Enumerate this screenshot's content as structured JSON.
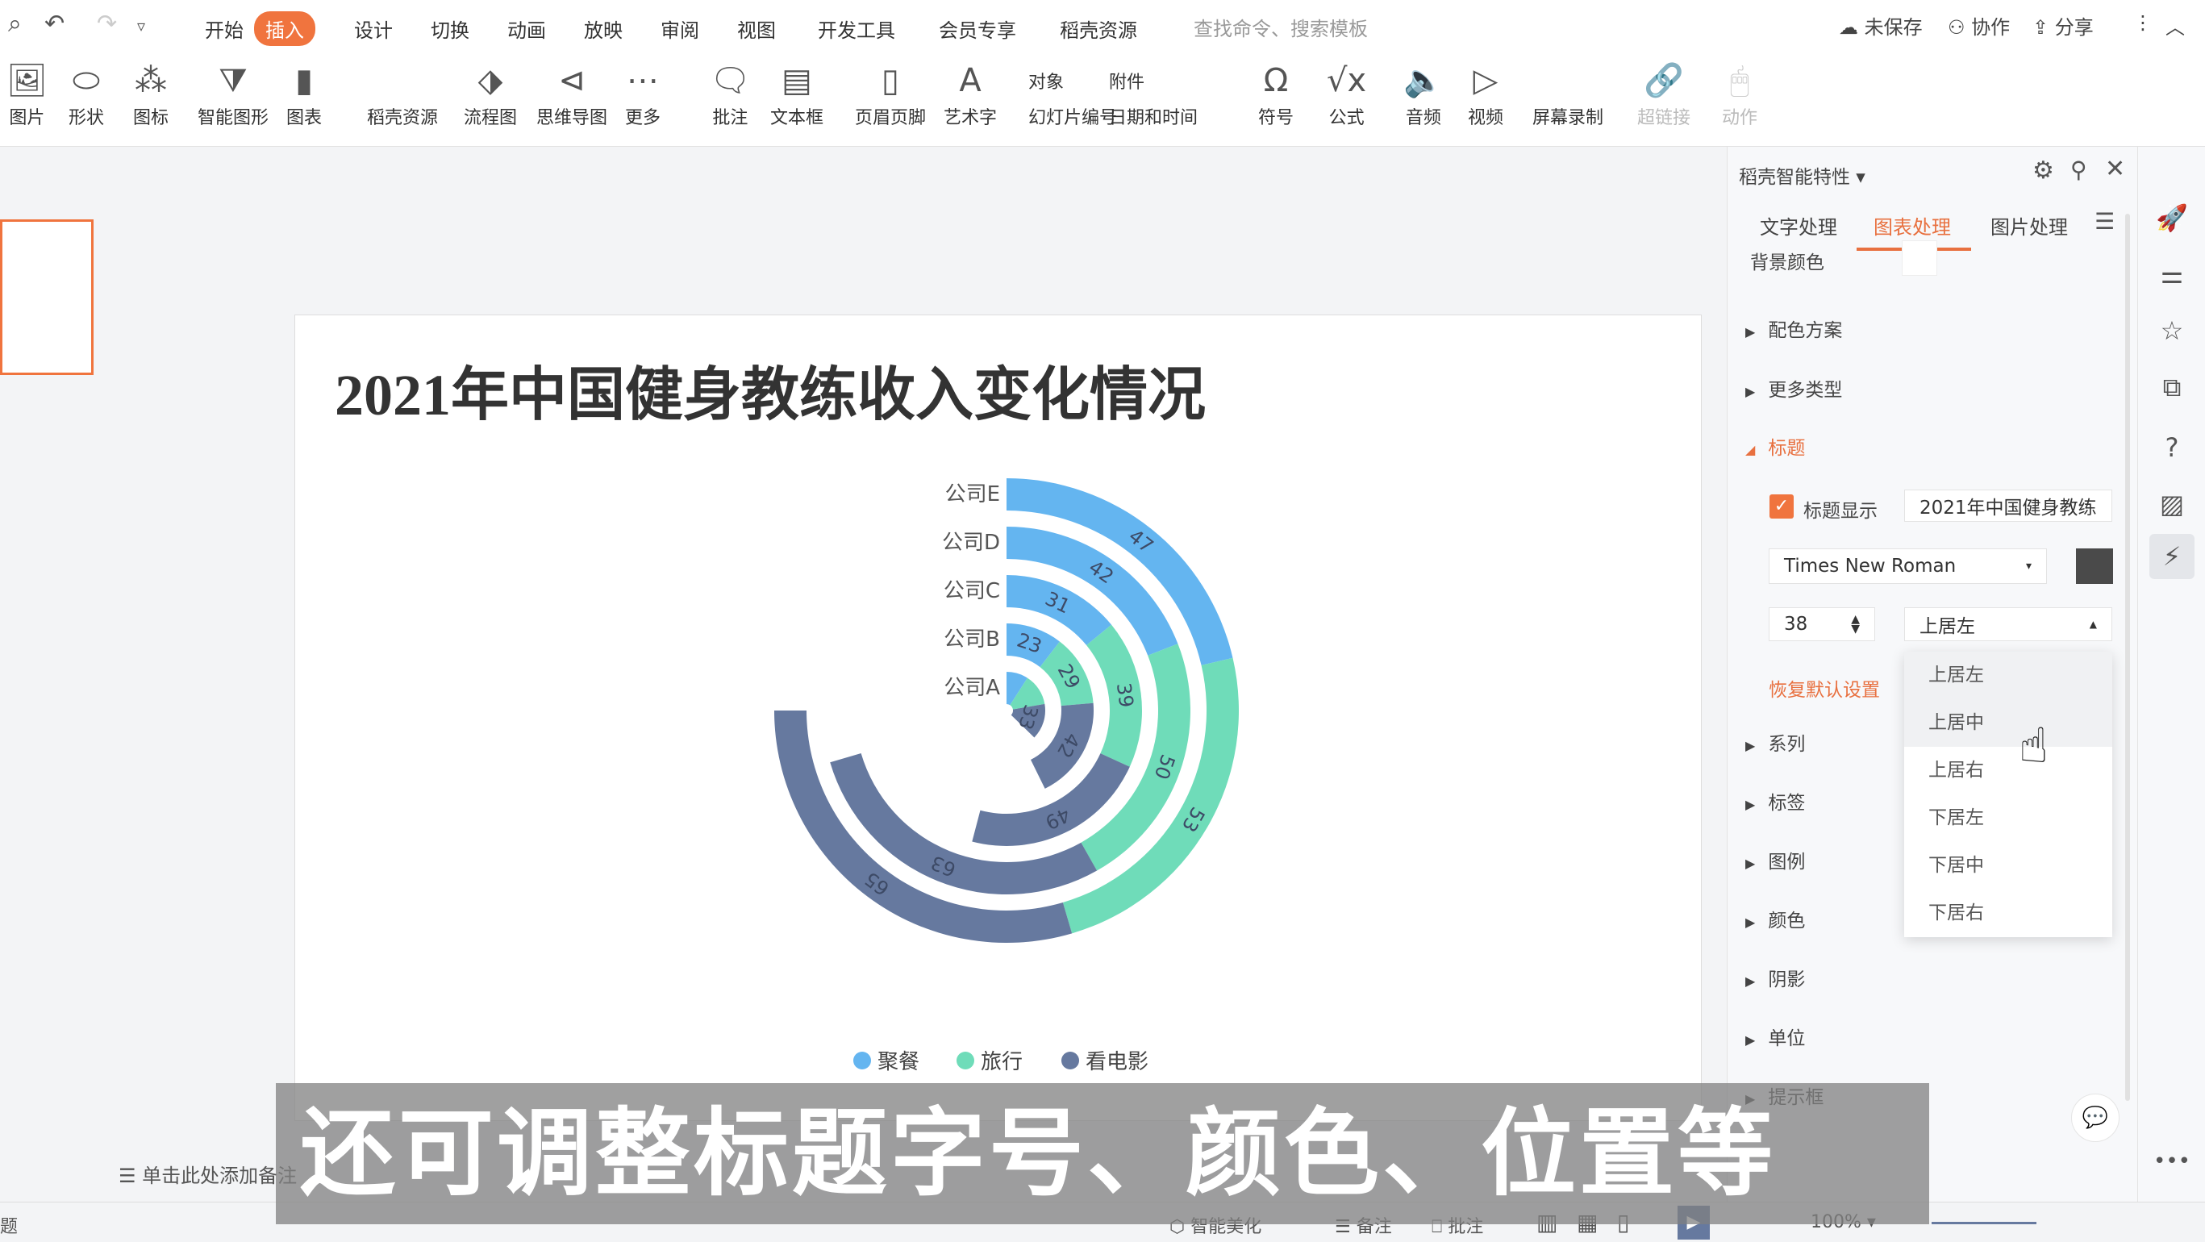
{
  "menubar": {
    "tabs": [
      "开始",
      "插入",
      "设计",
      "切换",
      "动画",
      "放映",
      "审阅",
      "视图",
      "开发工具",
      "会员专享",
      "稻壳资源"
    ],
    "active_tab": "插入",
    "search_placeholder": "查找命令、搜索模板",
    "unsaved": "未保存",
    "collab": "协作",
    "share": "分享"
  },
  "ribbon": {
    "items": [
      "图片",
      "形状",
      "图标",
      "智能图形",
      "图表",
      "稻壳资源",
      "流程图",
      "思维导图",
      "更多",
      "批注",
      "文本框",
      "页眉页脚",
      "艺术字"
    ],
    "small": [
      "对象",
      "附件",
      "幻灯片编号",
      "日期和时间"
    ],
    "items2": [
      "符号",
      "公式",
      "音频",
      "视频",
      "屏幕录制"
    ],
    "disabled": [
      "超链接",
      "动作"
    ]
  },
  "slide": {
    "title": "2021年中国健身教练收入变化情况"
  },
  "chart_data": {
    "type": "polar-stacked-bar",
    "categories": [
      "公司A",
      "公司B",
      "公司C",
      "公司D",
      "公司E"
    ],
    "series": [
      {
        "name": "聚餐",
        "color": "#64b5f0",
        "values": [
          20,
          23,
          31,
          42,
          47
        ]
      },
      {
        "name": "旅行",
        "color": "#6fdcb9",
        "values": [
          29,
          29,
          39,
          50,
          53
        ]
      },
      {
        "name": "看电影",
        "color": "#66799f",
        "values": [
          33,
          42,
          49,
          63,
          65
        ]
      }
    ],
    "labels": [
      [
        null,
        "23",
        "31",
        "42",
        "47"
      ],
      [
        null,
        "29",
        "39",
        "50",
        "53"
      ],
      [
        "33",
        "42",
        "49",
        "63",
        "65"
      ]
    ],
    "legend": "bottom"
  },
  "notes": {
    "placeholder": "单击此处添加备注"
  },
  "panel": {
    "title": "稻壳智能特性",
    "tabs": [
      "文字处理",
      "图表处理",
      "图片处理"
    ],
    "active_tab": "图表处理",
    "bg_color_label": "背景颜色",
    "sections_top": [
      "配色方案",
      "更多类型"
    ],
    "title_section": "标题",
    "title_show_label": "标题显示",
    "title_show_checked": true,
    "title_text": "2021年中国健身教练",
    "font": "Times New Roman",
    "font_color": "#4a4a4a",
    "font_size": "38",
    "position": "上居左",
    "reset": "恢复默认设置",
    "sections": [
      "系列",
      "标签",
      "图例",
      "颜色",
      "阴影",
      "单位",
      "提示框"
    ],
    "position_options": [
      "上居左",
      "上居中",
      "上居右",
      "下居左",
      "下居中",
      "下居右"
    ],
    "hovered_option": "上居中"
  },
  "subtitle": "还可调整标题字号、颜色、位置等",
  "statusbar": {
    "left": "题",
    "smart": "智能美化",
    "notes": "备注",
    "comment": "批注",
    "zoom": "100%"
  }
}
